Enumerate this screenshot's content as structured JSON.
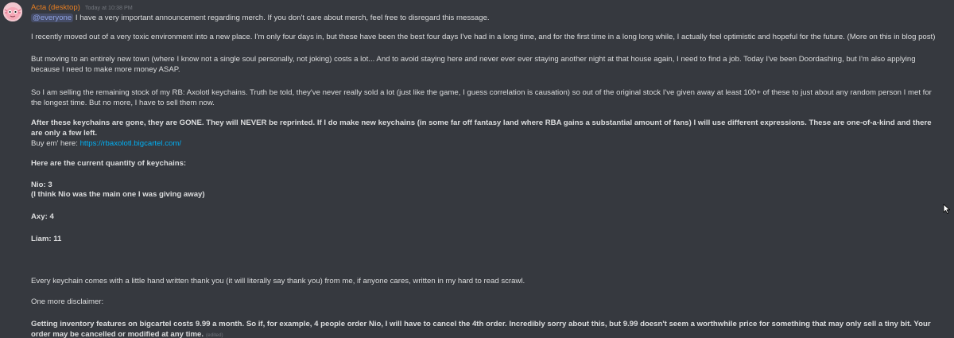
{
  "message": {
    "username": "Acta (desktop)",
    "timestamp": "Today at 10:38 PM",
    "mention": "@everyone",
    "intro": "I have a very important announcement regarding merch. If you don't care about merch, feel free to disregard this message.",
    "p1": "I recently moved out of a very toxic environment into a new place. I'm only four days in, but these have been the best four days I've had in a long time, and for the first time in a long long while, I actually feel optimistic and hopeful for the future. (More on this in blog post)",
    "p2": "But moving to an entirely new town (where I know not a single soul personally, not joking) costs a lot... And to avoid staying here and never ever ever staying another night at that house again, I need to find a job. Today I've been Doordashing, but I'm also applying because I need to make more money ASAP.",
    "p3": "So I am selling the remaining stock of my RB: Axolotl keychains. Truth be told, they've never really sold a lot (just like the game, I guess correlation is causation) so out of the original stock I've given away at least 100+ of these to just about any random person I met for the longest time. But no more, I have to sell them now.",
    "p4": "After these keychains are gone, they are GONE. They will NEVER be reprinted. If I do make new keychains (in some far off fantasy land where RBA gains a substantial amount of fans) I will use different expressions. These are one-of-a-kind and there are only a few left.",
    "buy_prefix": "Buy em' here:",
    "buy_link": "https://rbaxolotl.bigcartel.com/",
    "quantity_heading": "Here are the current quantity of keychains:",
    "nio": "Nio: 3",
    "nio_note": "(I think Nio was the main one I was giving away)",
    "axy": "Axy: 4",
    "liam": "Liam: 11",
    "p5": "Every keychain comes with a little hand written thank you (it will literally say thank you) from me, if anyone cares, written in my hard to read scrawl.",
    "disclaimer_heading": "One more disclaimer:",
    "p6": "Getting inventory features on bigcartel costs 9.99 a month. So if, for example, 4 people order Nio, I will have to cancel the 4th order. Incredibly sorry about this, but 9.99 doesn't seem a worthwhile price for something that may only sell a tiny bit. Your order may be cancelled or modified at any time.",
    "edited": "(edited)"
  },
  "colors": {
    "background": "#36393f",
    "text": "#dcddde",
    "username": "#e67e22",
    "link": "#00b0f4",
    "mention_text": "#8ea1e1",
    "muted": "#72767d"
  },
  "icons": {
    "avatar": "pink-axolotl-avatar",
    "cursor": "mouse-pointer-icon"
  }
}
